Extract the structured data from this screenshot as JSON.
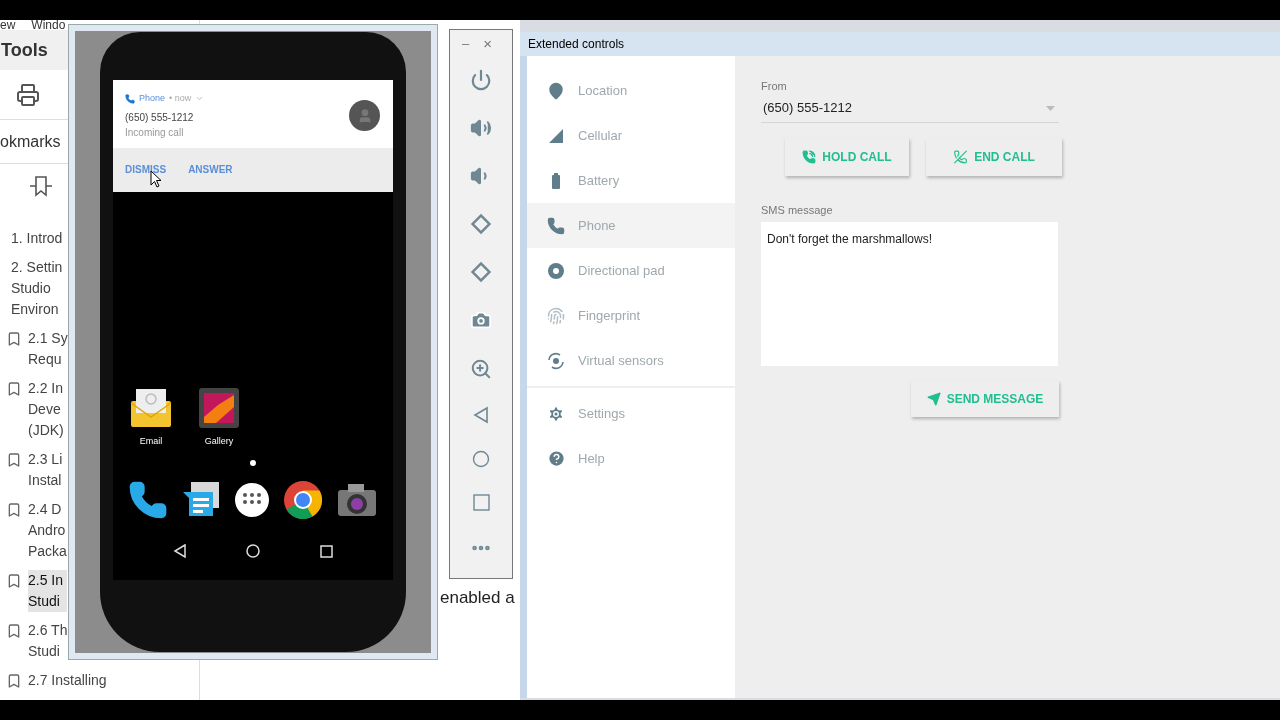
{
  "pdf_reader": {
    "menu": [
      "ew",
      "Windo"
    ],
    "tools_title": "Tools",
    "bookmarks_title": "okmarks",
    "bookmarks": [
      {
        "kind": "chapter",
        "lines": [
          "1. Introd"
        ],
        "selected": false
      },
      {
        "kind": "chapter",
        "lines": [
          "2. Settin",
          "Studio",
          "Environ"
        ],
        "selected": false
      },
      {
        "kind": "bookmark",
        "lines": [
          "2.1 Sy",
          "Requ"
        ],
        "selected": false
      },
      {
        "kind": "bookmark",
        "lines": [
          "2.2 In",
          "Deve",
          "(JDK)"
        ],
        "selected": false
      },
      {
        "kind": "bookmark",
        "lines": [
          "2.3 Li",
          "Instal"
        ],
        "selected": false
      },
      {
        "kind": "bookmark",
        "lines": [
          "2.4 D",
          "Andro",
          "Packa"
        ],
        "selected": false
      },
      {
        "kind": "bookmark",
        "lines": [
          "2.5 In",
          "Studi"
        ],
        "selected": true
      },
      {
        "kind": "bookmark",
        "lines": [
          "2.6 Th",
          "Studi"
        ],
        "selected": false
      },
      {
        "kind": "bookmark",
        "lines": [
          "2.7 Installing"
        ],
        "selected": false
      }
    ],
    "document_text": "enabled a"
  },
  "emulator": {
    "notification": {
      "app": "Phone",
      "meta": "• now",
      "caller": "(650) 555-1212",
      "status": "Incoming call",
      "actions": [
        "DISMISS",
        "ANSWER"
      ]
    },
    "home_apps": [
      {
        "label": "Email"
      },
      {
        "label": "Gallery"
      }
    ]
  },
  "toolbar": {
    "minimize": "–",
    "close": "×"
  },
  "extended_controls": {
    "title": "Extended controls",
    "nav": [
      {
        "label": "Location",
        "selected": false
      },
      {
        "label": "Cellular",
        "selected": false
      },
      {
        "label": "Battery",
        "selected": false
      },
      {
        "label": "Phone",
        "selected": true
      },
      {
        "label": "Directional pad",
        "selected": false
      },
      {
        "label": "Fingerprint",
        "selected": false
      },
      {
        "label": "Virtual sensors",
        "selected": false
      }
    ],
    "nav_bottom": [
      {
        "label": "Settings",
        "selected": false
      },
      {
        "label": "Help",
        "selected": false
      }
    ],
    "from_label": "From",
    "from_value": "(650) 555-1212",
    "call_buttons": [
      "HOLD CALL",
      "END CALL"
    ],
    "sms_label": "SMS message",
    "sms_value": "Don't forget the marshmallows!",
    "send_button": "SEND MESSAGE"
  }
}
